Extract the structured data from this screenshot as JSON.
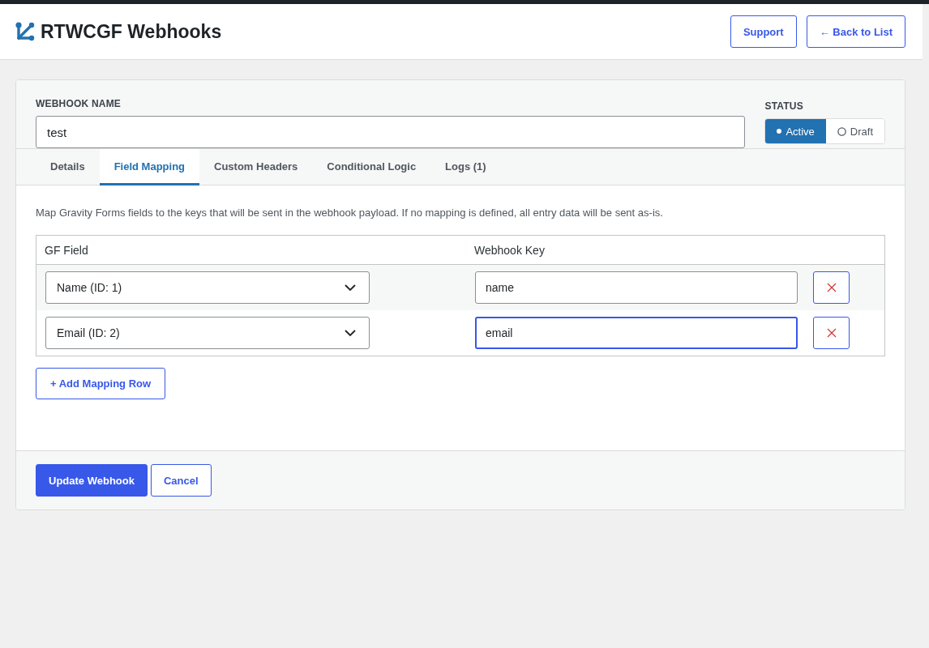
{
  "header": {
    "title": "RTWCGF Webhooks",
    "buttons": [
      "Support",
      "← Back to List"
    ]
  },
  "webhook_name": {
    "label": "WEBHOOK NAME",
    "value": "test"
  },
  "status": {
    "label": "STATUS",
    "options": [
      {
        "label": "Active",
        "selected": true
      },
      {
        "label": "Draft",
        "selected": false
      }
    ]
  },
  "tabs": [
    {
      "label": "Details",
      "selected": false
    },
    {
      "label": "Field Mapping",
      "selected": true
    },
    {
      "label": "Custom Headers",
      "selected": false
    },
    {
      "label": "Conditional Logic",
      "selected": false
    },
    {
      "label": "Logs (1)",
      "selected": false
    }
  ],
  "field_mapping": {
    "description": "Map Gravity Forms fields to the keys that will be sent in the webhook payload. If no mapping is defined, all entry data will be sent as-is.",
    "columns": [
      "GF Field",
      "Webhook Key"
    ],
    "rows": [
      {
        "gf_field": "Name (ID: 1)",
        "webhook_key": "name",
        "focused": false
      },
      {
        "gf_field": "Email (ID: 2)",
        "webhook_key": "email",
        "focused": true
      }
    ],
    "add_button": "+ Add Mapping Row"
  },
  "footer": {
    "buttons": [
      {
        "label": "Update Webhook",
        "kind": "primary"
      },
      {
        "label": "Cancel",
        "kind": "secondary"
      }
    ]
  }
}
